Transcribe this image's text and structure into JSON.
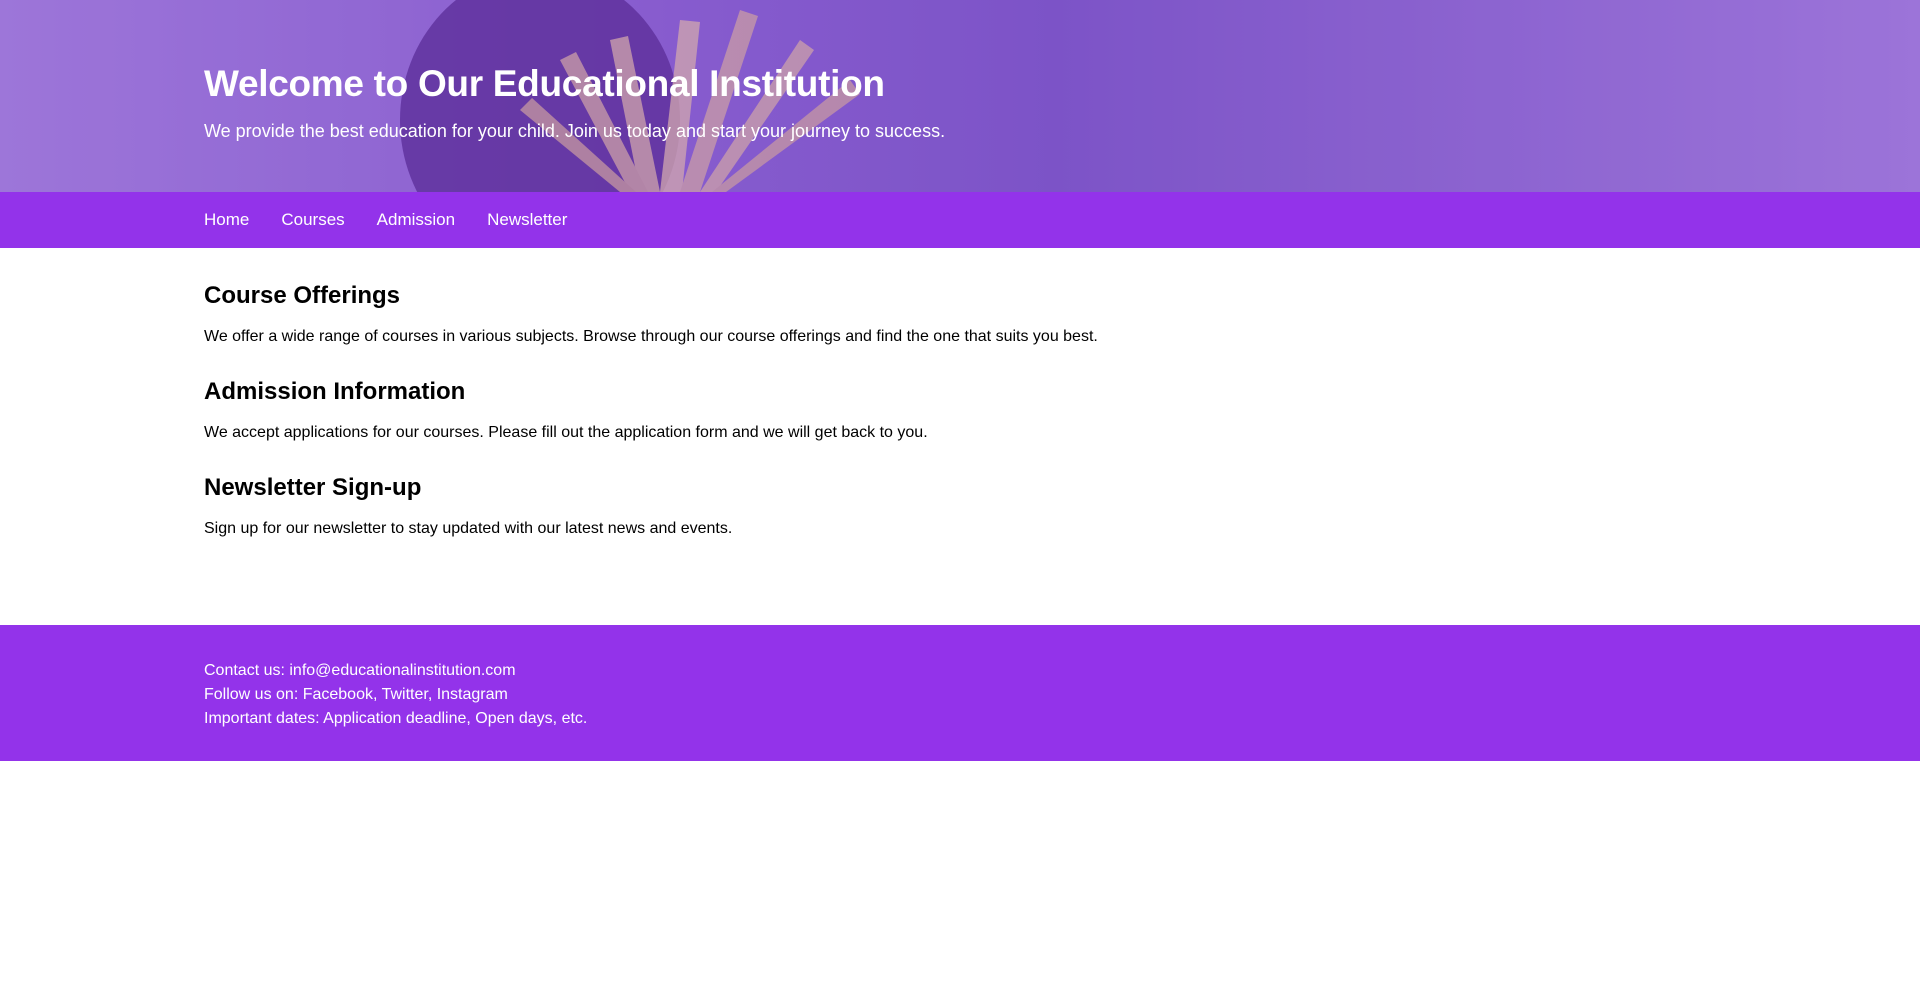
{
  "hero": {
    "title": "Welcome to Our Educational Institution",
    "subtitle": "We provide the best education for your child. Join us today and start your journey to success."
  },
  "nav": {
    "items": [
      {
        "label": "Home"
      },
      {
        "label": "Courses"
      },
      {
        "label": "Admission"
      },
      {
        "label": "Newsletter"
      }
    ]
  },
  "sections": [
    {
      "title": "Course Offerings",
      "body": "We offer a wide range of courses in various subjects. Browse through our course offerings and find the one that suits you best."
    },
    {
      "title": "Admission Information",
      "body": "We accept applications for our courses. Please fill out the application form and we will get back to you."
    },
    {
      "title": "Newsletter Sign-up",
      "body": "Sign up for our newsletter to stay updated with our latest news and events."
    }
  ],
  "footer": {
    "contact": "Contact us: info@educationalinstitution.com",
    "follow": "Follow us on: Facebook, Twitter, Instagram",
    "dates": "Important dates: Application deadline, Open days, etc."
  },
  "colors": {
    "primary": "#9333ea",
    "hero_overlay": "#9b72d6",
    "text": "#000000",
    "on_primary": "#ffffff"
  }
}
